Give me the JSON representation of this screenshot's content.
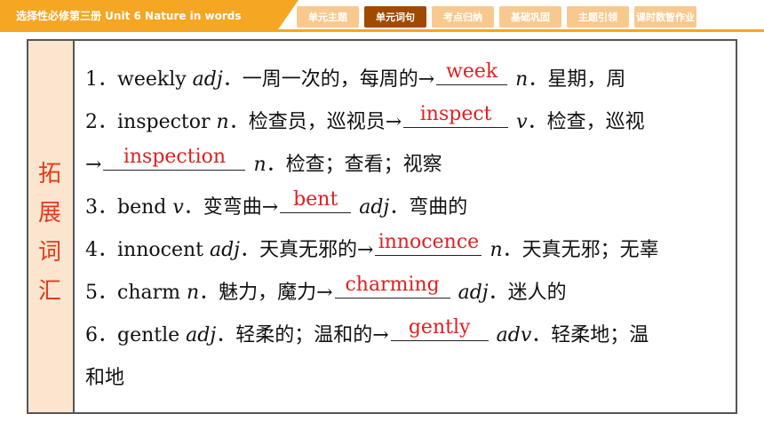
{
  "header": {
    "banner": "选择性必修第三册    Unit 6    Nature in words",
    "tabs": [
      {
        "label": "单元主题",
        "active": false
      },
      {
        "label": "单元词句",
        "active": true
      },
      {
        "label": "考点归纳",
        "active": false
      },
      {
        "label": "基础巩固",
        "active": false
      },
      {
        "label": "主题引领",
        "active": false
      },
      {
        "label": "课时数智作业",
        "active": false
      }
    ]
  },
  "side": {
    "chars": [
      "拓",
      "展",
      "词",
      "汇"
    ]
  },
  "items": [
    {
      "num": "1．",
      "word": "weekly ",
      "pos": "adj",
      "meaning": "．一周一次的，每周的→",
      "answer": "week",
      "pos2": "n",
      "meaning2": "．星期，周"
    },
    {
      "num": "2．",
      "word": "inspector ",
      "pos": "n",
      "meaning": "．检查员，巡视员→",
      "answer": "inspect",
      "pos2": "v",
      "meaning2": "．检查，巡视"
    },
    {
      "num": "",
      "word": "",
      "pos": "",
      "meaning": "→",
      "answer": "inspection",
      "pos2": "n",
      "meaning2": "．检查；查看；视察"
    },
    {
      "num": "3．",
      "word": "bend ",
      "pos": "v",
      "meaning": "．变弯曲→",
      "answer": "bent",
      "pos2": "adj",
      "meaning2": "．弯曲的"
    },
    {
      "num": "4．",
      "word": "innocent ",
      "pos": "adj",
      "meaning": "．天真无邪的→",
      "answer": "innocence",
      "pos2": "n",
      "meaning2": "．天真无邪；无辜"
    },
    {
      "num": "5．",
      "word": "charm ",
      "pos": "n",
      "meaning": "．魅力，魔力→",
      "answer": "charming",
      "pos2": "adj",
      "meaning2": "．迷人的"
    },
    {
      "num": "6．",
      "word": "gentle ",
      "pos": "adj",
      "meaning": "．轻柔的；温和的→",
      "answer": "gently",
      "pos2": "adv",
      "meaning2": "．轻柔地；温"
    },
    {
      "num": "",
      "word": "",
      "pos": "",
      "meaning": "和地",
      "answer": "",
      "pos2": "",
      "meaning2": ""
    }
  ],
  "colors": {
    "accent": "#f5a623",
    "active_tab": "#a04a00",
    "answer": "#e02020",
    "side_bg": "#fbe5cf",
    "side_text": "#e23b1a"
  }
}
